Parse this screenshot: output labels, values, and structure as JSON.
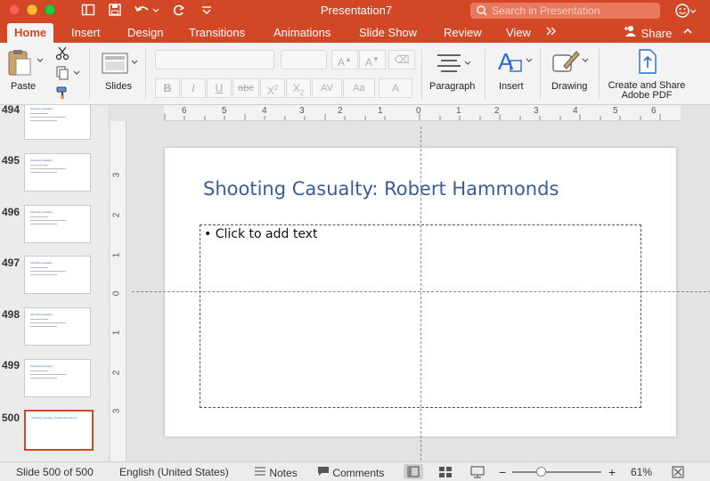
{
  "window": {
    "title": "Presentation7",
    "search_placeholder": "Search in Presentation"
  },
  "tabs": [
    {
      "label": "Home"
    },
    {
      "label": "Insert"
    },
    {
      "label": "Design"
    },
    {
      "label": "Transitions"
    },
    {
      "label": "Animations"
    },
    {
      "label": "Slide Show"
    },
    {
      "label": "Review"
    },
    {
      "label": "View"
    }
  ],
  "share_label": "Share",
  "ribbon": {
    "paste": "Paste",
    "slides": "Slides",
    "paragraph": "Paragraph",
    "insert": "Insert",
    "drawing": "Drawing",
    "create_share_line1": "Create and Share",
    "create_share_line2": "Adobe PDF"
  },
  "slide_panel": {
    "items": [
      {
        "number": "494",
        "title": "Shooting Casualty: ..."
      },
      {
        "number": "495",
        "title": "Shooting Casualty: ..."
      },
      {
        "number": "496",
        "title": "Shooting Casualty: ..."
      },
      {
        "number": "497",
        "title": "Shooting Casualty: ..."
      },
      {
        "number": "498",
        "title": "Shooting Casualty: ..."
      },
      {
        "number": "499",
        "title": "Shooting Casualty: ..."
      },
      {
        "number": "500",
        "title": "Shooting Casualty: Robert Hammonds"
      }
    ]
  },
  "slide": {
    "title": "Shooting Casualty: Robert Hammonds",
    "body_placeholder": "• Click to add text"
  },
  "ruler": {
    "h_labels": [
      "6",
      "5",
      "4",
      "3",
      "2",
      "1",
      "0",
      "1",
      "2",
      "3",
      "4",
      "5",
      "6"
    ],
    "v_labels": [
      "3",
      "2",
      "1",
      "0",
      "1",
      "2",
      "3"
    ]
  },
  "status": {
    "slide_indicator": "Slide 500 of 500",
    "language": "English (United States)",
    "notes": "Notes",
    "comments": "Comments",
    "zoom": "61%"
  },
  "colors": {
    "accent": "#d24726",
    "title_blue": "#3c5c95"
  }
}
